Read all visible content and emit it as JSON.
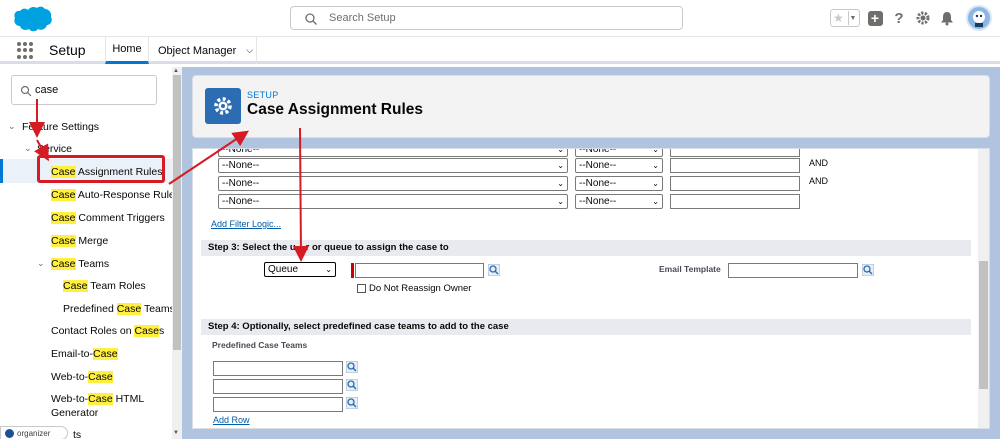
{
  "header": {
    "search_placeholder": "Search Setup"
  },
  "nav": {
    "app_name": "Setup",
    "tabs": [
      {
        "label": "Home"
      },
      {
        "label": "Object Manager"
      }
    ]
  },
  "sidebar": {
    "quickfind_value": "case",
    "items": [
      {
        "pre": "",
        "hl": "",
        "post": "Feature Settings"
      },
      {
        "pre": "",
        "hl": "",
        "post": "Service"
      },
      {
        "pre": "",
        "hl": "Case",
        "post": " Assignment Rules"
      },
      {
        "pre": "",
        "hl": "Case",
        "post": " Auto-Response Rules"
      },
      {
        "pre": "",
        "hl": "Case",
        "post": " Comment Triggers"
      },
      {
        "pre": "",
        "hl": "Case",
        "post": " Merge"
      },
      {
        "pre": "",
        "hl": "Case",
        "post": " Teams"
      },
      {
        "pre": "",
        "hl": "Case",
        "post": " Team Roles"
      },
      {
        "pre": "Predefined ",
        "hl": "Case",
        "post": " Teams"
      },
      {
        "pre": "Contact Roles on ",
        "hl": "Case",
        "post": "s"
      },
      {
        "pre": "Email-to-",
        "hl": "Case",
        "post": ""
      },
      {
        "pre": "Web-to-",
        "hl": "Case",
        "post": ""
      },
      {
        "pre": "Web-to-",
        "hl": "Case",
        "post": " HTML"
      },
      {
        "pre": "Generator",
        "hl": "",
        "post": ""
      },
      {
        "pre": "",
        "hl": "",
        "post": "ts"
      }
    ],
    "organizer_label": "organizer"
  },
  "page": {
    "breadcrumb": "SETUP",
    "title": "Case Assignment Rules"
  },
  "form": {
    "none_option": "--None--",
    "and_label": "AND",
    "add_filter_logic": "Add Filter Logic...",
    "step3": "Step 3: Select the user or queue to assign the case to",
    "step3_shown": "Step 3: Select the u",
    "step3_tail": "r or queue to assign the case to",
    "assign_type": "Queue",
    "email_template_label": "Email Template",
    "do_not_reassign": "Do Not Reassign Owner",
    "step4": "Step 4: Optionally, select predefined case teams to add to the case",
    "predefined_label": "Predefined Case Teams",
    "add_row": "Add Row"
  },
  "colors": {
    "brand_blue": "#0176d3",
    "annotation_red": "#d51b24",
    "highlight": "#fff03f"
  }
}
